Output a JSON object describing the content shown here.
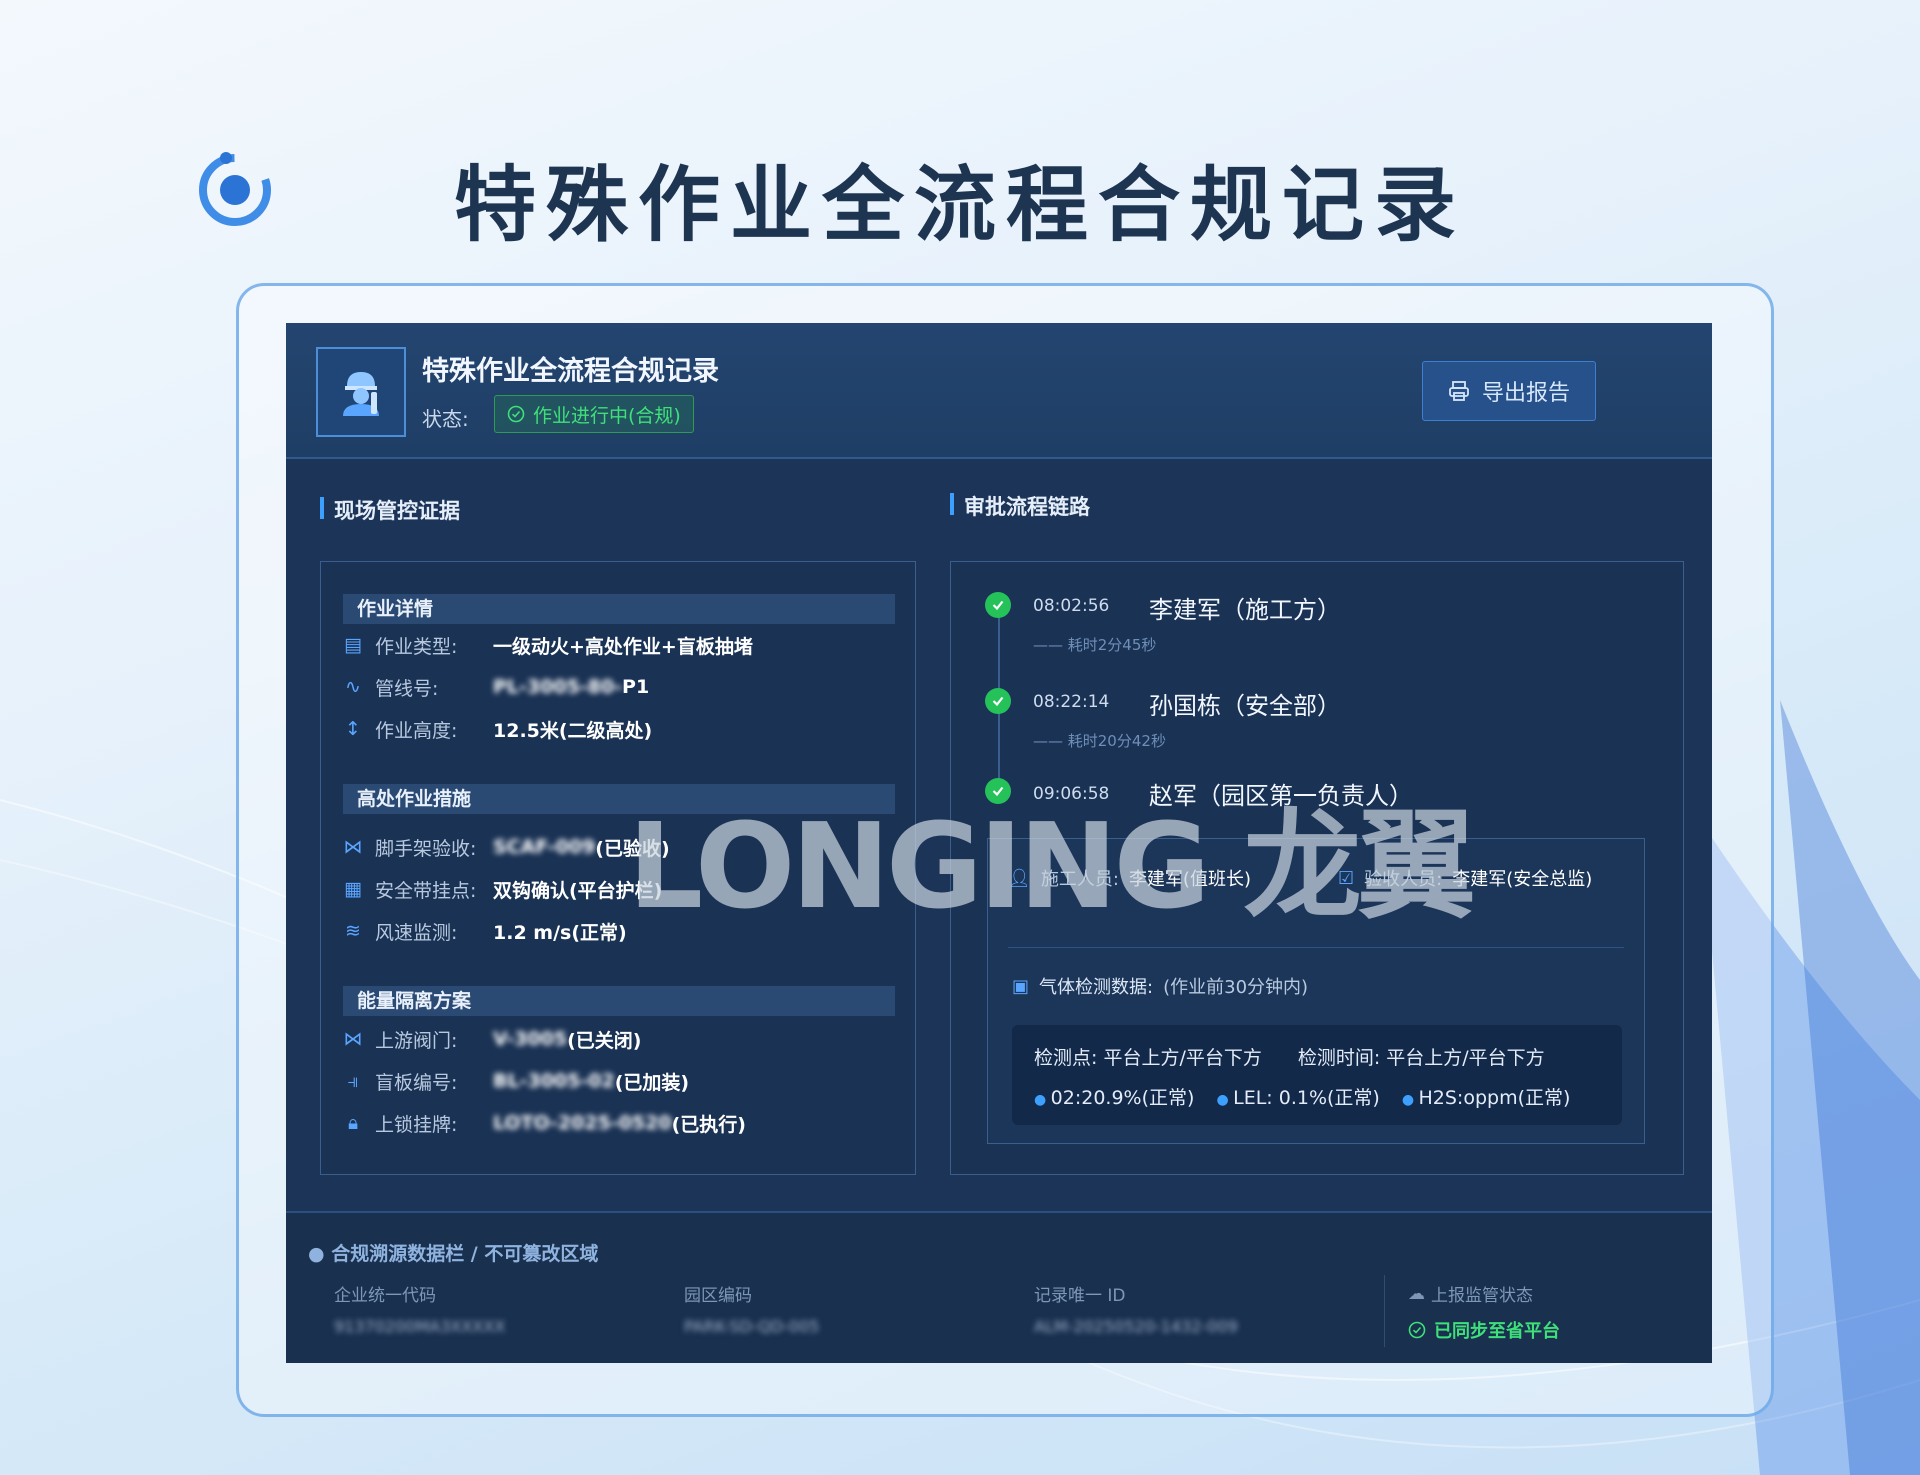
{
  "page_title": "特殊作业全流程合规记录",
  "header": {
    "title": "特殊作业全流程合规记录",
    "status_label": "状态:",
    "status_badge": "作业进行中(合规)",
    "export_label": "导出报告"
  },
  "left": {
    "section_title": "现场管控证据",
    "groups": [
      {
        "title": "作业详情",
        "rows": [
          {
            "icon": "document-icon",
            "label": "作业类型:",
            "value": "一级动火+高处作业+盲板抽堵"
          },
          {
            "icon": "pipeline-icon",
            "label": "管线号:",
            "value_blur": "PL-3005-80-",
            "value": "P1"
          },
          {
            "icon": "height-icon",
            "label": "作业高度:",
            "value": "12.5米(二级高处)"
          }
        ]
      },
      {
        "title": "高处作业措施",
        "rows": [
          {
            "icon": "scaffold-icon",
            "label": "脚手架验收:",
            "value_blur": "SCAF-009",
            "value": "(已验收)"
          },
          {
            "icon": "harness-icon",
            "label": "安全带挂点:",
            "value": "双钩确认(平台护栏)"
          },
          {
            "icon": "wind-icon",
            "label": "风速监测:",
            "value": "1.2 m/s(正常)"
          }
        ]
      },
      {
        "title": "能量隔离方案",
        "rows": [
          {
            "icon": "valve-icon",
            "label": "上游阀门:",
            "value_blur": "V-3005",
            "value": "(已关闭)"
          },
          {
            "icon": "blind-plate-icon",
            "label": "盲板编号:",
            "value_blur": "BL-3005-02",
            "value": "(已加装)"
          },
          {
            "icon": "lock-icon",
            "label": "上锁挂牌:",
            "value_blur": "LOTO-2025-0520",
            "value": "(已执行)"
          }
        ]
      }
    ]
  },
  "right": {
    "section_title": "审批流程链路",
    "steps": [
      {
        "time": "08:02:56",
        "name": "李建军（施工方）",
        "duration": "—— 耗时2分45秒"
      },
      {
        "time": "08:22:14",
        "name": "孙国栋（安全部）",
        "duration": "—— 耗时20分42秒"
      },
      {
        "time": "09:06:58",
        "name": "赵军（园区第一负责人）"
      }
    ],
    "worker_label": "施工人员:",
    "worker_value": "李建军(值班长)",
    "inspector_label": "验收人员:",
    "inspector_value": "李建军(安全总监)",
    "gas_title": "气体检测数据:",
    "gas_note": "(作业前30分钟内)",
    "gas_point": "检测点: 平台上方/平台下方",
    "gas_time": "检测时间: 平台上方/平台下方",
    "gas_values": [
      "02:20.9%(正常)",
      "LEL: 0.1%(正常)",
      "H2S:oppm(正常)"
    ]
  },
  "footer": {
    "title": "● 合规溯源数据栏 / 不可篡改区域",
    "fields": [
      {
        "label": "企业统一代码",
        "value": "91370200MA3XXXXX"
      },
      {
        "label": "园区编码",
        "value": "PARK-SD-QD-005"
      },
      {
        "label": "记录唯一 ID",
        "value": "ALM-20250520-1432-009"
      }
    ],
    "report_label": "上报监管状态",
    "report_value": "已同步至省平台"
  },
  "watermark": "LONGING 龙翼",
  "colors": {
    "accent": "#3da0ff",
    "success": "#25c25a",
    "panel": "#1b3457",
    "title": "#1e3552"
  }
}
